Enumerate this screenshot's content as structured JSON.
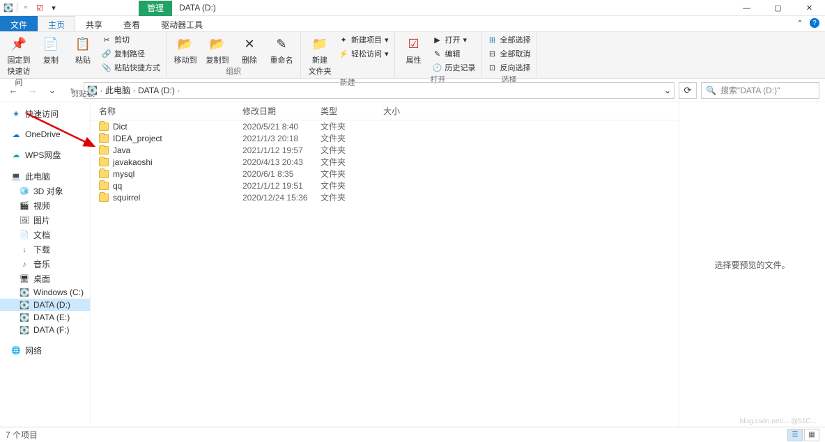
{
  "window": {
    "title": "DATA (D:)",
    "context_tab": "管理"
  },
  "menutabs": {
    "file": "文件",
    "home": "主页",
    "share": "共享",
    "view": "查看",
    "drive_tools": "驱动器工具"
  },
  "ribbon": {
    "pin": "固定到\n快速访问",
    "copy": "复制",
    "paste": "粘贴",
    "cut": "剪切",
    "copy_path": "复制路径",
    "paste_shortcut": "粘贴快捷方式",
    "clipboard_group": "剪贴板",
    "move_to": "移动到",
    "copy_to": "复制到",
    "delete": "删除",
    "rename": "重命名",
    "organize_group": "组织",
    "new_folder": "新建\n文件夹",
    "new_item": "新建项目",
    "easy_access": "轻松访问",
    "new_group": "新建",
    "properties": "属性",
    "open": "打开",
    "edit": "编辑",
    "history": "历史记录",
    "open_group": "打开",
    "select_all": "全部选择",
    "select_none": "全部取消",
    "invert_selection": "反向选择",
    "select_group": "选择"
  },
  "address": {
    "this_pc": "此电脑",
    "data_d": "DATA (D:)"
  },
  "search": {
    "placeholder": "搜索\"DATA (D:)\""
  },
  "columns": {
    "name": "名称",
    "date": "修改日期",
    "type": "类型",
    "size": "大小"
  },
  "nav": {
    "quick_access": "快速访问",
    "onedrive": "OneDrive",
    "wps": "WPS网盘",
    "this_pc": "此电脑",
    "objects3d": "3D 对象",
    "videos": "视频",
    "pictures": "图片",
    "documents": "文档",
    "downloads": "下载",
    "music": "音乐",
    "desktop": "桌面",
    "windows_c": "Windows (C:)",
    "data_d": "DATA (D:)",
    "data_e": "DATA (E:)",
    "data_f": "DATA (F:)",
    "network": "网络"
  },
  "files": [
    {
      "name": "Dict",
      "date": "2020/5/21 8:40",
      "type": "文件夹"
    },
    {
      "name": "IDEA_project",
      "date": "2021/1/3 20:18",
      "type": "文件夹"
    },
    {
      "name": "Java",
      "date": "2021/1/12 19:57",
      "type": "文件夹"
    },
    {
      "name": "javakaoshi",
      "date": "2020/4/13 20:43",
      "type": "文件夹"
    },
    {
      "name": "mysql",
      "date": "2020/6/1 8:35",
      "type": "文件夹"
    },
    {
      "name": "qq",
      "date": "2021/1/12 19:51",
      "type": "文件夹"
    },
    {
      "name": "squirrel",
      "date": "2020/12/24 15:36",
      "type": "文件夹"
    }
  ],
  "preview": {
    "empty": "选择要预览的文件。"
  },
  "status": {
    "count": "7 个项目"
  },
  "icons": {
    "min": "—",
    "max": "▢",
    "close": "✕",
    "back": "←",
    "forward": "→",
    "up": "↑",
    "refresh": "⟳",
    "search": "🔍",
    "chevron": "›",
    "dropdown": "⌄",
    "star": "★",
    "cloud": "☁",
    "disk": "💽",
    "pc": "💻",
    "cube": "🧊",
    "video": "🎬",
    "image": "🖼",
    "doc": "📄",
    "down": "↓",
    "music": "♪",
    "desktop": "🖥",
    "drive": "💾",
    "net": "🌐",
    "pin": "📌",
    "copy": "📋",
    "paste": "📋",
    "cut": "✂",
    "folder": "📁",
    "props": "✓",
    "history": "🕘",
    "check": "☑"
  }
}
